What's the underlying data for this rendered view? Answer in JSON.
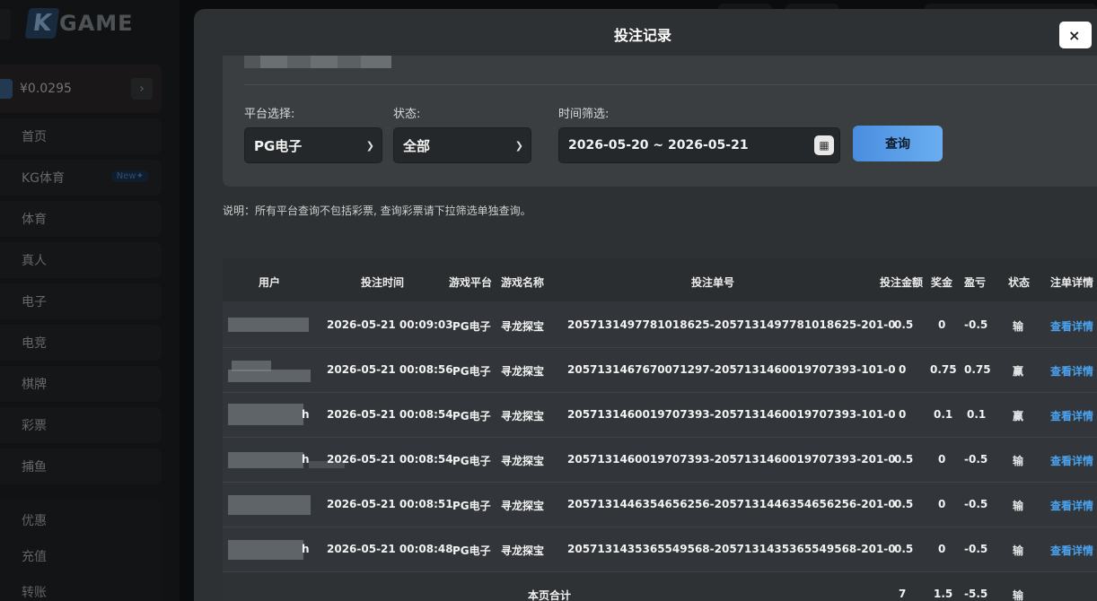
{
  "app": {
    "logo_letter": "K",
    "logo_text": "GAME"
  },
  "account": {
    "balance": "¥0.0295",
    "arrow": "›"
  },
  "sidebar": {
    "items": [
      {
        "label": "首页"
      },
      {
        "label": "KG体育",
        "badge": "New✦"
      },
      {
        "label": "体育"
      },
      {
        "label": "真人"
      },
      {
        "label": "电子"
      },
      {
        "label": "电竞"
      },
      {
        "label": "棋牌"
      },
      {
        "label": "彩票"
      },
      {
        "label": "捕鱼"
      }
    ],
    "sub_items": [
      {
        "label": "优惠"
      },
      {
        "label": "充值"
      },
      {
        "label": "转账"
      }
    ]
  },
  "modal": {
    "title": "投注记录",
    "close": "×"
  },
  "filters": {
    "platform_label": "平台选择:",
    "platform_value": "PG电子",
    "status_label": "状态:",
    "status_value": "全部",
    "time_label": "时间筛选:",
    "date_range": "2026-05-20 ~ 2026-05-21",
    "query_label": "查询"
  },
  "note": "说明：所有平台查询不包括彩票, 查询彩票请下拉筛选单独查询。",
  "table": {
    "headers": {
      "user": "用户",
      "time": "投注时间",
      "platform": "游戏平台",
      "game": "游戏名称",
      "order": "投注单号",
      "bet": "投注金额",
      "prize": "奖金",
      "profit": "盈亏",
      "status": "状态",
      "detail": "注单详情"
    },
    "rows": [
      {
        "user_tail": "",
        "time": "2026-05-21 00:09:03",
        "platform": "PG电子",
        "game": "寻龙探宝",
        "order": "2057131497781018625-2057131497781018625-201-0",
        "bet": "0.5",
        "prize": "0",
        "profit": "-0.5",
        "status": "输",
        "detail": "查看详情"
      },
      {
        "user_tail": "",
        "time": "2026-05-21 00:08:56",
        "platform": "PG电子",
        "game": "寻龙探宝",
        "order": "2057131467670071297-2057131460019707393-101-0",
        "bet": "0",
        "prize": "0.75",
        "profit": "0.75",
        "status": "赢",
        "detail": "查看详情"
      },
      {
        "user_tail": "h",
        "time": "2026-05-21 00:08:54",
        "platform": "PG电子",
        "game": "寻龙探宝",
        "order": "2057131460019707393-2057131460019707393-101-0",
        "bet": "0",
        "prize": "0.1",
        "profit": "0.1",
        "status": "赢",
        "detail": "查看详情"
      },
      {
        "user_tail": "h",
        "time": "2026-05-21 00:08:54",
        "platform": "PG电子",
        "game": "寻龙探宝",
        "order": "2057131460019707393-2057131460019707393-201-0",
        "bet": "0.5",
        "prize": "0",
        "profit": "-0.5",
        "status": "输",
        "detail": "查看详情"
      },
      {
        "user_tail": "",
        "time": "2026-05-21 00:08:51",
        "platform": "PG电子",
        "game": "寻龙探宝",
        "order": "2057131446354656256-2057131446354656256-201-0",
        "bet": "0.5",
        "prize": "0",
        "profit": "-0.5",
        "status": "输",
        "detail": "查看详情"
      },
      {
        "user_tail": "h",
        "time": "2026-05-21 00:08:48",
        "platform": "PG电子",
        "game": "寻龙探宝",
        "order": "2057131435365549568-2057131435365549568-201-0",
        "bet": "0.5",
        "prize": "0",
        "profit": "-0.5",
        "status": "输",
        "detail": "查看详情"
      }
    ],
    "summary": {
      "label": "本页合计",
      "bet": "7",
      "prize": "1.5",
      "profit": "-5.5",
      "status": "输"
    }
  }
}
